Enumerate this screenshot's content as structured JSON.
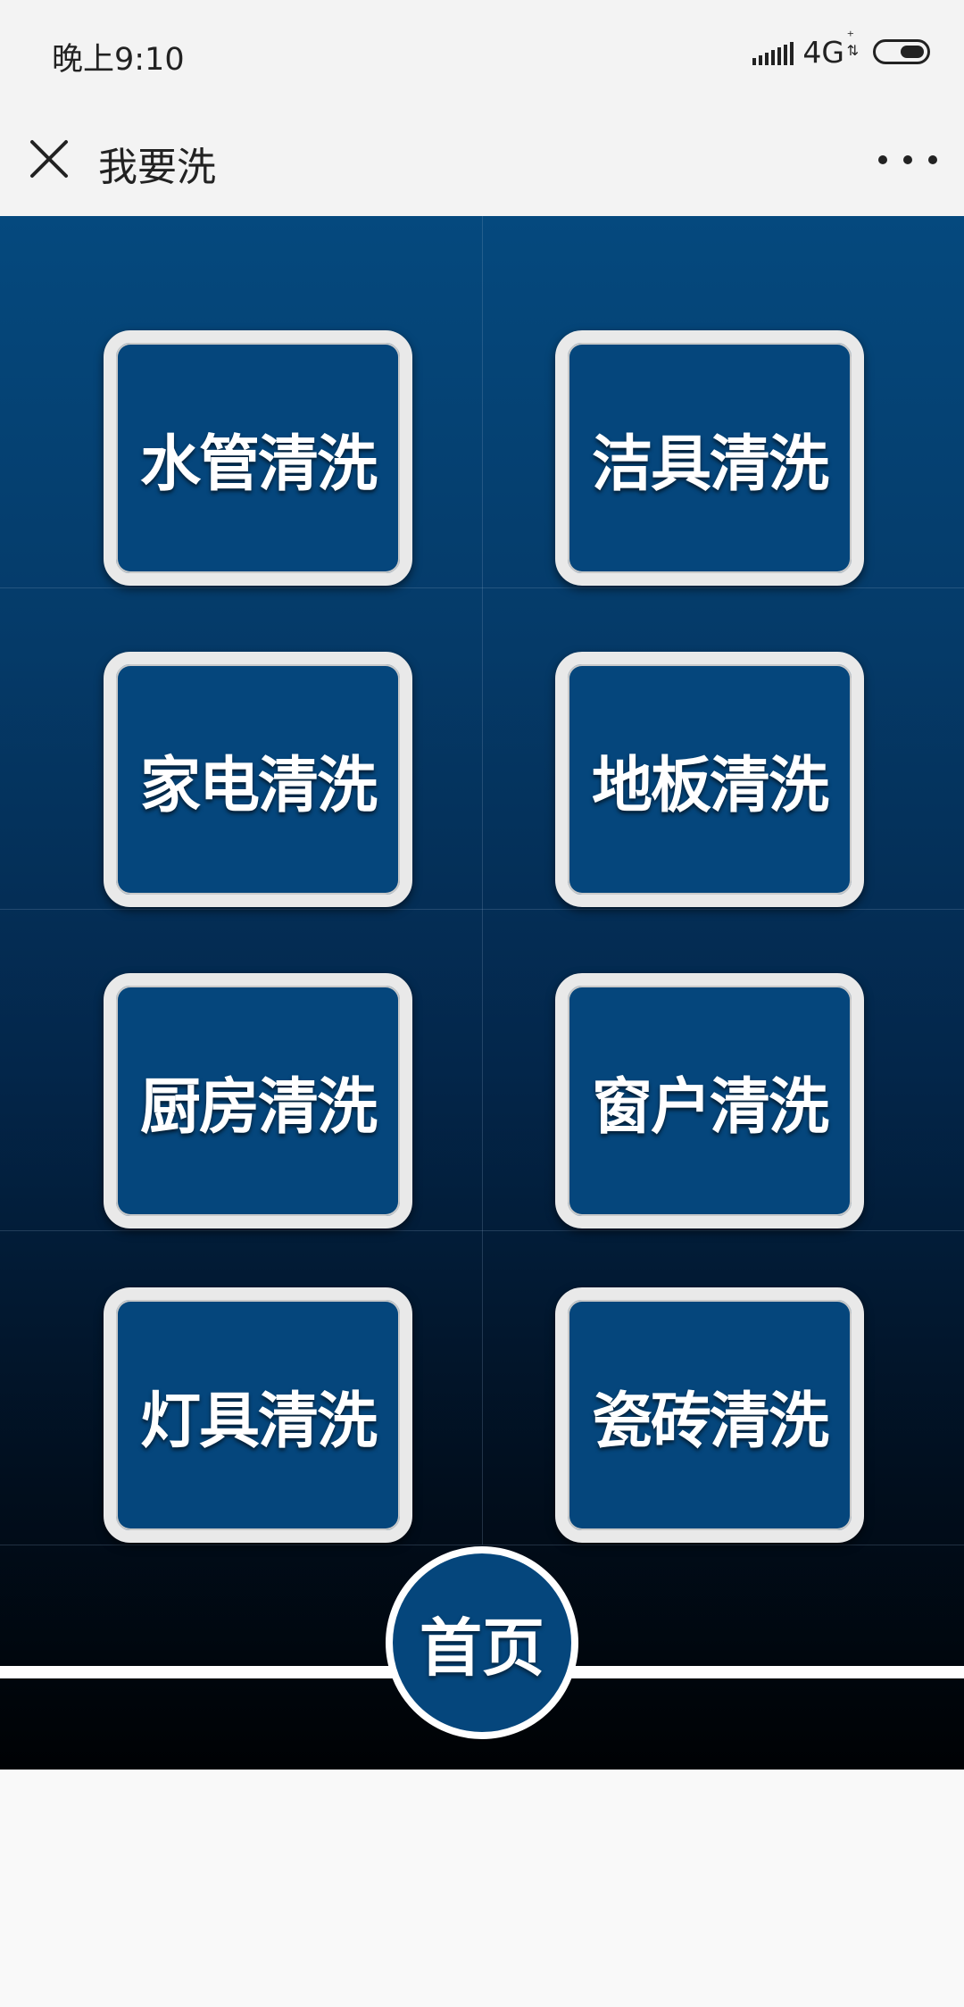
{
  "status_bar": {
    "time": "晚上9:10",
    "network": "4G",
    "icons": [
      "signal-icon",
      "battery-icon"
    ]
  },
  "nav": {
    "title": "我要洗",
    "close_icon": "close-icon",
    "more_icon": "more-icon"
  },
  "tiles": [
    {
      "label": "水管清洗"
    },
    {
      "label": "洁具清洗"
    },
    {
      "label": "家电清洗"
    },
    {
      "label": "地板清洗"
    },
    {
      "label": "厨房清洗"
    },
    {
      "label": "窗户清洗"
    },
    {
      "label": "灯具清洗"
    },
    {
      "label": "瓷砖清洗"
    }
  ],
  "home_button": {
    "label": "首页"
  },
  "colors": {
    "tile_fill": "#05467c",
    "tile_border": "#e9e9e9",
    "background_top": "#05497e",
    "background_bottom": "#000204"
  }
}
